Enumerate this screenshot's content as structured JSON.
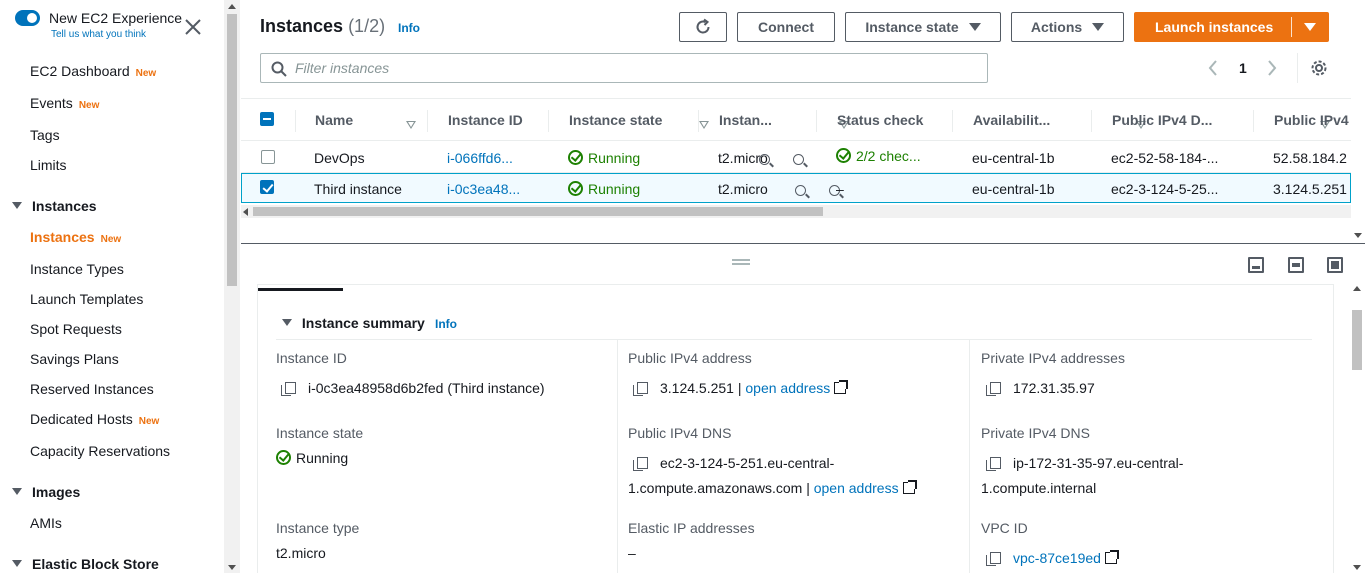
{
  "sidebar": {
    "experience_title": "New EC2 Experience",
    "experience_link": "Tell us what you think",
    "new_badge": "New",
    "items": [
      {
        "label": "EC2 Dashboard",
        "new": true
      },
      {
        "label": "Events",
        "new": true
      },
      {
        "label": "Tags",
        "new": false
      },
      {
        "label": "Limits",
        "new": false
      }
    ],
    "sections": {
      "instances": {
        "title": "Instances",
        "items": [
          {
            "label": "Instances",
            "new": true,
            "active": true
          },
          {
            "label": "Instance Types"
          },
          {
            "label": "Launch Templates"
          },
          {
            "label": "Spot Requests"
          },
          {
            "label": "Savings Plans"
          },
          {
            "label": "Reserved Instances"
          },
          {
            "label": "Dedicated Hosts",
            "new": true
          },
          {
            "label": "Capacity Reservations"
          }
        ]
      },
      "images": {
        "title": "Images",
        "items": [
          {
            "label": "AMIs"
          }
        ]
      },
      "ebs": {
        "title": "Elastic Block Store"
      }
    }
  },
  "header": {
    "title": "Instances",
    "count": "(1/2)",
    "info": "Info",
    "connect": "Connect",
    "instance_state": "Instance state",
    "actions": "Actions",
    "launch": "Launch instances"
  },
  "filter": {
    "placeholder": "Filter instances",
    "page": "1"
  },
  "table": {
    "columns": [
      "Name",
      "Instance ID",
      "Instance state",
      "Instan...",
      "Status check",
      "Availabilit...",
      "Public IPv4 D...",
      "Public IPv4"
    ],
    "rows": [
      {
        "name": "DevOps",
        "id": "i-066ffd6...",
        "state": "Running",
        "type": "t2.micro",
        "status": "2/2 chec...",
        "az": "eu-central-1b",
        "dns": "ec2-52-58-184-...",
        "ip": "52.58.184.2"
      },
      {
        "name": "Third instance",
        "id": "i-0c3ea48...",
        "state": "Running",
        "type": "t2.micro",
        "status": "–",
        "az": "eu-central-1b",
        "dns": "ec2-3-124-5-25...",
        "ip": "3.124.5.251"
      }
    ]
  },
  "details": {
    "section_title": "Instance summary",
    "info": "Info",
    "instance_id_label": "Instance ID",
    "instance_id": "i-0c3ea48958d6b2fed (Third instance)",
    "public_ip_label": "Public IPv4 address",
    "public_ip": "3.124.5.251",
    "open_address": "open address",
    "private_ip_label": "Private IPv4 addresses",
    "private_ip": "172.31.35.97",
    "state_label": "Instance state",
    "state": "Running",
    "public_dns_label": "Public IPv4 DNS",
    "public_dns_1": "ec2-3-124-5-251.eu-central-",
    "public_dns_2": "1.compute.amazonaws.com",
    "private_dns_label": "Private IPv4 DNS",
    "private_dns_1": "ip-172-31-35-97.eu-central-",
    "private_dns_2": "1.compute.internal",
    "type_label": "Instance type",
    "type": "t2.micro",
    "eip_label": "Elastic IP addresses",
    "eip": "–",
    "vpc_label": "VPC ID",
    "vpc": "vpc-87ce19ed"
  },
  "colors": {
    "accent": "#ec7211",
    "link": "#0073bb",
    "success": "#1d8102"
  }
}
